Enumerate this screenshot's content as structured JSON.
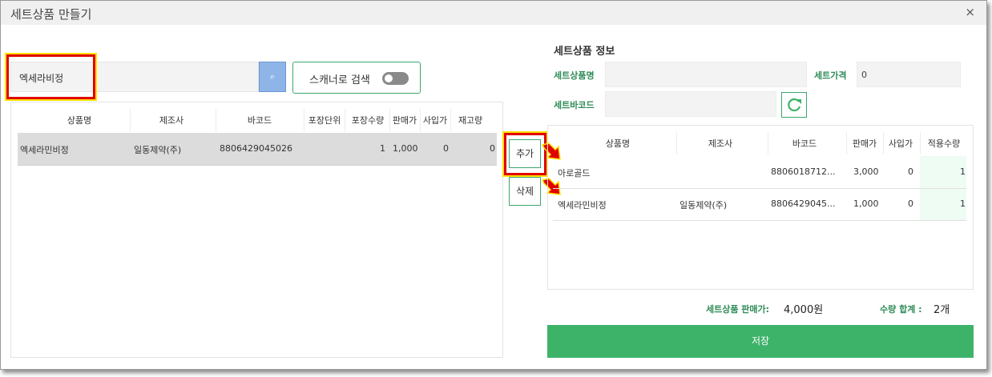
{
  "window": {
    "title": "세트상품 만들기",
    "close_glyph": "×"
  },
  "search": {
    "value": "엑세라비정",
    "button_glyph": "⌕"
  },
  "scanner": {
    "label": "스캐너로 검색",
    "enabled": false
  },
  "product_table": {
    "columns": [
      "상품명",
      "제조사",
      "바코드",
      "포장단위",
      "포장수량",
      "판매가",
      "사입가",
      "재고량"
    ],
    "rows": [
      {
        "name": "엑세라민비정",
        "maker": "일동제약(주)",
        "barcode": "8806429045026",
        "unit": "",
        "qty": "1",
        "price": "1,000",
        "cost": "0",
        "stock": "0"
      }
    ]
  },
  "actions": {
    "add_label": "추가",
    "delete_label": "삭제"
  },
  "set_info": {
    "title": "세트상품 정보",
    "name_label": "세트상품명",
    "name_value": "",
    "price_label": "세트가격",
    "price_value": "0",
    "barcode_label": "세트바코드",
    "barcode_value": ""
  },
  "set_table": {
    "columns": [
      "상품명",
      "제조사",
      "바코드",
      "판매가",
      "사입가",
      "적용수량"
    ],
    "rows": [
      {
        "name": "아로골드",
        "maker": "",
        "barcode": "8806018712...",
        "price": "3,000",
        "cost": "0",
        "qty": "1"
      },
      {
        "name": "엑세라민비정",
        "maker": "일동제약(주)",
        "barcode": "8806429045...",
        "price": "1,000",
        "cost": "0",
        "qty": "1"
      }
    ]
  },
  "summary": {
    "price_label": "세트상품 판매가:",
    "price_value": "4,000원",
    "qty_label": "수량 합계 :",
    "qty_value": "2개"
  },
  "save_label": "저장",
  "colors": {
    "accent_green": "#3db36a",
    "label_green": "#2e8b57",
    "highlight_red": "#e00000",
    "highlight_yellow": "#ffe000",
    "search_blue": "#8fb5e8"
  }
}
